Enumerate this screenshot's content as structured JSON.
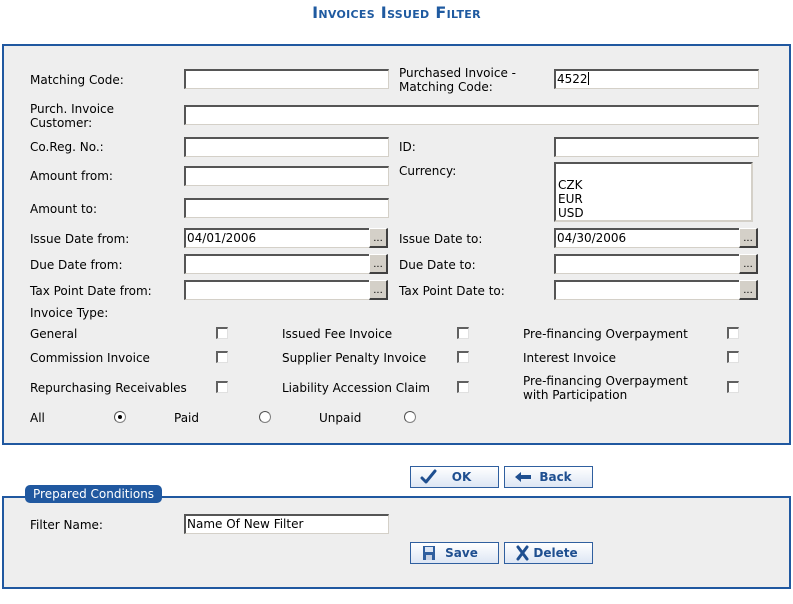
{
  "page": {
    "title": "Invoices Issued Filter"
  },
  "filter": {
    "matching_code": {
      "label": "Matching Code:",
      "value": ""
    },
    "purchased_invoice_matching_code": {
      "label_line1": "Purchased Invoice -",
      "label_line2": "Matching Code:",
      "value": "4522"
    },
    "purch_invoice_customer": {
      "label_line1": "Purch. Invoice",
      "label_line2": "Customer:",
      "value": ""
    },
    "co_reg_no": {
      "label": "Co.Reg. No.:",
      "value": ""
    },
    "id": {
      "label": "ID:",
      "value": ""
    },
    "amount_from": {
      "label": "Amount from:",
      "value": ""
    },
    "amount_to": {
      "label": "Amount to:",
      "value": ""
    },
    "currency": {
      "label": "Currency:",
      "options": [
        "",
        "CZK",
        "EUR",
        "USD"
      ]
    },
    "issue_date_from": {
      "label": "Issue Date from:",
      "value": "04/01/2006"
    },
    "issue_date_to": {
      "label": "Issue Date to:",
      "value": "04/30/2006"
    },
    "due_date_from": {
      "label": "Due Date from:",
      "value": ""
    },
    "due_date_to": {
      "label": "Due Date to:",
      "value": ""
    },
    "tax_point_date_from": {
      "label": "Tax Point Date from:",
      "value": ""
    },
    "tax_point_date_to": {
      "label": "Tax Point Date to:",
      "value": ""
    },
    "date_picker_label": "...",
    "invoice_type": {
      "label": "Invoice Type:",
      "types": [
        {
          "label": "General",
          "checked": false
        },
        {
          "label": "Issued Fee Invoice",
          "checked": false
        },
        {
          "label": "Pre-financing Overpayment",
          "checked": false
        },
        {
          "label": "Commission Invoice",
          "checked": false
        },
        {
          "label": "Supplier Penalty Invoice",
          "checked": false
        },
        {
          "label": "Interest Invoice",
          "checked": false
        },
        {
          "label": "Repurchasing Receivables",
          "checked": false
        },
        {
          "label": "Liability Accession Claim",
          "checked": false
        },
        {
          "label_line1": "Pre-financing Overpayment",
          "label_line2": "with Participation",
          "checked": false
        }
      ]
    },
    "payment_status": {
      "options": [
        {
          "label": "All",
          "selected": true
        },
        {
          "label": "Paid",
          "selected": false
        },
        {
          "label": "Unpaid",
          "selected": false
        }
      ]
    }
  },
  "actions": {
    "ok_label": "OK",
    "back_label": "Back"
  },
  "prepared_conditions": {
    "legend": "Prepared Conditions",
    "filter_name_label": "Filter Name:",
    "filter_name_value": "Name Of New Filter",
    "save_label": "Save",
    "delete_label": "Delete"
  },
  "colors": {
    "accent": "#2058a0",
    "panel_bg": "#eeeeee",
    "button_text": "#1f4f90"
  }
}
